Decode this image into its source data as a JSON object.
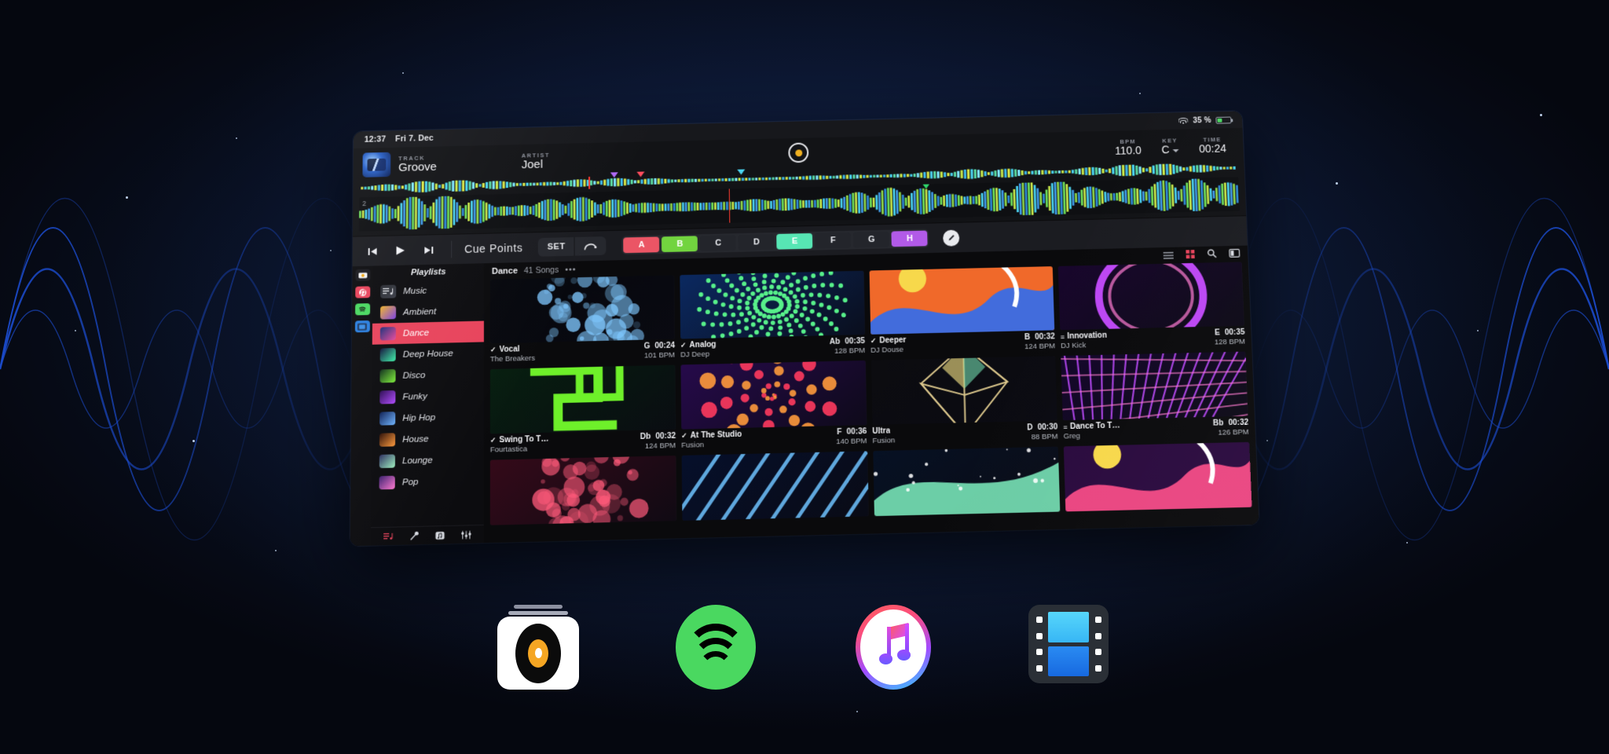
{
  "statusbar": {
    "time": "12:37",
    "date": "Fri 7. Dec",
    "battery_percent": "35 %",
    "wifi_icon": "wifi-icon",
    "battery_icon": "battery-icon"
  },
  "deck": {
    "track_label": "TRACK",
    "track_value": "Groove",
    "artist_label": "ARTIST",
    "artist_value": "Joel",
    "bpm_label": "BPM",
    "bpm_value": "110.0",
    "key_label": "KEY",
    "key_value": "C",
    "time_label": "TIME",
    "time_value": "00:24",
    "record_icon": "record-icon",
    "overview_deck_number": "2"
  },
  "transport": {
    "prev_icon": "skip-previous-icon",
    "play_icon": "play-icon",
    "next_icon": "skip-next-icon",
    "cue_title": "Cue Points",
    "set_label": "SET",
    "loop_icon": "loop-arrow-icon",
    "edit_icon": "edit-pencil-icon",
    "cue_points": [
      {
        "label": "A",
        "color": "#eb5565",
        "active": true
      },
      {
        "label": "B",
        "color": "#72d43f",
        "active": true
      },
      {
        "label": "C",
        "color": "#23252b",
        "active": false
      },
      {
        "label": "D",
        "color": "#23252b",
        "active": false
      },
      {
        "label": "E",
        "color": "#57e6b4",
        "active": true
      },
      {
        "label": "F",
        "color": "#23252b",
        "active": false
      },
      {
        "label": "G",
        "color": "#23252b",
        "active": false
      },
      {
        "label": "H",
        "color": "#b25ae8",
        "active": true
      }
    ]
  },
  "rail": {
    "items": [
      {
        "name": "camera-icon",
        "color": "#f3a712",
        "bg": "#1a1a1f"
      },
      {
        "name": "music-library-icon",
        "color": "#ffffff",
        "bg": "#e8445c"
      },
      {
        "name": "spotify-icon",
        "color": "#ffffff",
        "bg": "#4ad860"
      },
      {
        "name": "video-icon",
        "color": "#ffffff",
        "bg": "#2a7fe0"
      }
    ]
  },
  "sidebar": {
    "header": "Playlists",
    "items": [
      {
        "label": "Music",
        "icon": "music-list-icon",
        "c1": "#2a2c33",
        "c2": "#3a3d46",
        "active": false
      },
      {
        "label": "Ambient",
        "icon": "playlist-artwork",
        "c1": "#f0b429",
        "c2": "#7b3fe4",
        "active": false
      },
      {
        "label": "Dance",
        "icon": "playlist-artwork",
        "c1": "#1c2f7a",
        "c2": "#e84a9c",
        "active": true
      },
      {
        "label": "Deep House",
        "icon": "playlist-artwork",
        "c1": "#10103a",
        "c2": "#3ef0a8",
        "active": false
      },
      {
        "label": "Disco",
        "icon": "playlist-artwork",
        "c1": "#0d2c1a",
        "c2": "#7ef03a",
        "active": false
      },
      {
        "label": "Funky",
        "icon": "playlist-artwork",
        "c1": "#2a0a52",
        "c2": "#b14bff",
        "active": false
      },
      {
        "label": "Hip Hop",
        "icon": "playlist-artwork",
        "c1": "#0b1d52",
        "c2": "#6fb4ff",
        "active": false
      },
      {
        "label": "House",
        "icon": "playlist-artwork",
        "c1": "#2b0d05",
        "c2": "#ff9a3c",
        "active": false
      },
      {
        "label": "Lounge",
        "icon": "playlist-artwork",
        "c1": "#2b2d5e",
        "c2": "#9ff0c0",
        "active": false
      },
      {
        "label": "Pop",
        "icon": "playlist-artwork",
        "c1": "#3a1f6e",
        "c2": "#ff7ad1",
        "active": false
      }
    ],
    "bottom_nav": [
      {
        "name": "playlist-icon",
        "color": "#e8445c"
      },
      {
        "name": "microphone-icon",
        "color": "#d8dbe2"
      },
      {
        "name": "sampler-icon",
        "color": "#d8dbe2"
      },
      {
        "name": "mixer-icon",
        "color": "#d8dbe2"
      }
    ]
  },
  "content": {
    "title": "Dance",
    "subtitle": "41 Songs",
    "more_label": "•••",
    "toolbar_icons": [
      {
        "name": "list-view-icon",
        "color": "#8f939c"
      },
      {
        "name": "grid-view-icon",
        "color": "#e8445c"
      },
      {
        "name": "search-icon",
        "color": "#d8dbe2"
      },
      {
        "name": "sidebar-toggle-icon",
        "color": "#d8dbe2"
      }
    ],
    "tracks": [
      {
        "title": "Vocal",
        "artist": "The Breakers",
        "key": "G",
        "time": "00:24",
        "bpm": "101 BPM",
        "badge": "check",
        "c1": "#05070c",
        "c2": "#7fc8ff",
        "style": "dust"
      },
      {
        "title": "Analog",
        "artist": "DJ Deep",
        "key": "Ab",
        "time": "00:35",
        "bpm": "128 BPM",
        "badge": "check",
        "c1": "#0b2d6b",
        "c2": "#57f08a",
        "style": "dots"
      },
      {
        "title": "Deeper",
        "artist": "DJ Douse",
        "key": "B",
        "time": "00:32",
        "bpm": "124 BPM",
        "badge": "check",
        "c1": "#f0692a",
        "c2": "#2f6df0",
        "style": "abstract"
      },
      {
        "title": "Innovation",
        "artist": "DJ Kick",
        "key": "E",
        "time": "00:35",
        "bpm": "128 BPM",
        "badge": "list",
        "c1": "#1a0530",
        "c2": "#c64bff",
        "style": "ring"
      },
      {
        "title": "Swing To T…",
        "artist": "Fourtastica",
        "key": "Db",
        "time": "00:32",
        "bpm": "124 BPM",
        "badge": "check",
        "c1": "#06210f",
        "c2": "#6ef02a",
        "style": "glyph"
      },
      {
        "title": "At The Studio",
        "artist": "Fusion",
        "key": "F",
        "time": "00:36",
        "bpm": "140 BPM",
        "badge": "check",
        "c1": "#2a0a52",
        "c2": "#ff3a5e",
        "style": "spiral"
      },
      {
        "title": "Ultra",
        "artist": "Fusion",
        "key": "D",
        "time": "00:30",
        "bpm": "88 BPM",
        "badge": "none",
        "c1": "#0c0c10",
        "c2": "#d8c48a",
        "style": "poly"
      },
      {
        "title": "Dance To T…",
        "artist": "Greg",
        "key": "Bb",
        "time": "00:32",
        "bpm": "126 BPM",
        "badge": "list",
        "c1": "#15052e",
        "c2": "#c04bff",
        "style": "mesh"
      }
    ],
    "tracks_row3": [
      {
        "c1": "#3a0a1a",
        "c2": "#ff5a7a",
        "style": "dust"
      },
      {
        "c1": "#05102e",
        "c2": "#6fc4ff",
        "style": "lines"
      },
      {
        "c1": "#061226",
        "c2": "#7ef0c0",
        "style": "space"
      },
      {
        "c1": "#2a0a3e",
        "c2": "#ff4d88",
        "style": "abstract"
      }
    ]
  },
  "dock": {
    "apps": [
      {
        "name": "djay-app-icon",
        "label": "djay"
      },
      {
        "name": "spotify-app-icon",
        "label": "Spotify"
      },
      {
        "name": "itunes-app-icon",
        "label": "iTunes"
      },
      {
        "name": "video-app-icon",
        "label": "Video"
      }
    ]
  },
  "colors": {
    "accent_red": "#e8445c",
    "spotify_green": "#4ad860",
    "wave_blue": "#2f6df0"
  }
}
